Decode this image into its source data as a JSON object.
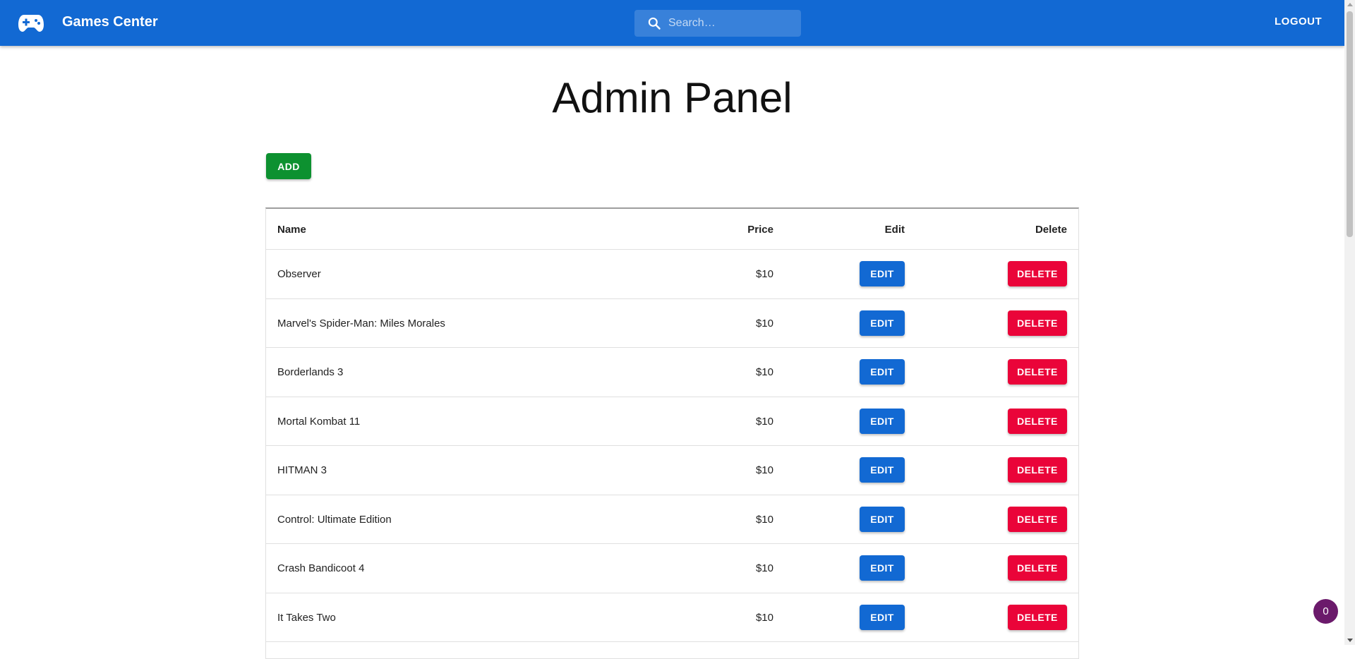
{
  "header": {
    "brand": "Games Center",
    "search_placeholder": "Search…",
    "logout_label": "LOGOUT"
  },
  "main": {
    "title": "Admin Panel",
    "add_label": "ADD"
  },
  "table": {
    "columns": [
      "Name",
      "Price",
      "Edit",
      "Delete"
    ],
    "edit_label": "EDIT",
    "delete_label": "DELETE",
    "rows": [
      {
        "name": "Observer",
        "price": "$10"
      },
      {
        "name": "Marvel's Spider-Man: Miles Morales",
        "price": "$10"
      },
      {
        "name": "Borderlands 3",
        "price": "$10"
      },
      {
        "name": "Mortal Kombat 11",
        "price": "$10"
      },
      {
        "name": "HITMAN 3",
        "price": "$10"
      },
      {
        "name": "Control: Ultimate Edition",
        "price": "$10"
      },
      {
        "name": "Crash Bandicoot 4",
        "price": "$10"
      },
      {
        "name": "It Takes Two",
        "price": "$10"
      }
    ]
  },
  "cart_badge": {
    "count": "0"
  },
  "colors": {
    "appbar": "#1269d3",
    "add": "#0d9130",
    "edit": "#1269d3",
    "delete": "#ea0439",
    "badge": "#6b1a6b"
  },
  "icons": {
    "logo": "gamepad-icon",
    "search": "search-icon"
  }
}
